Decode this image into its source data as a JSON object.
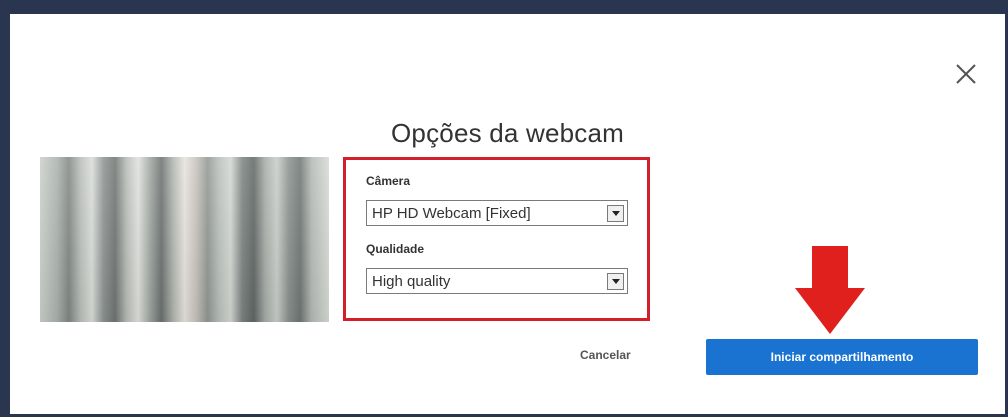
{
  "dialog": {
    "title": "Opções da webcam",
    "close_icon": "close-x-icon"
  },
  "camera": {
    "label": "Câmera",
    "selected": "HP HD Webcam [Fixed]"
  },
  "quality": {
    "label": "Qualidade",
    "selected": "High quality"
  },
  "actions": {
    "cancel_label": "Cancelar",
    "start_label": "Iniciar compartilhamento"
  },
  "annotation": {
    "highlight_color": "#d21f2a",
    "arrow_icon": "red-down-arrow-icon"
  },
  "colors": {
    "primary": "#1a73d0",
    "frame": "#2a3550"
  }
}
